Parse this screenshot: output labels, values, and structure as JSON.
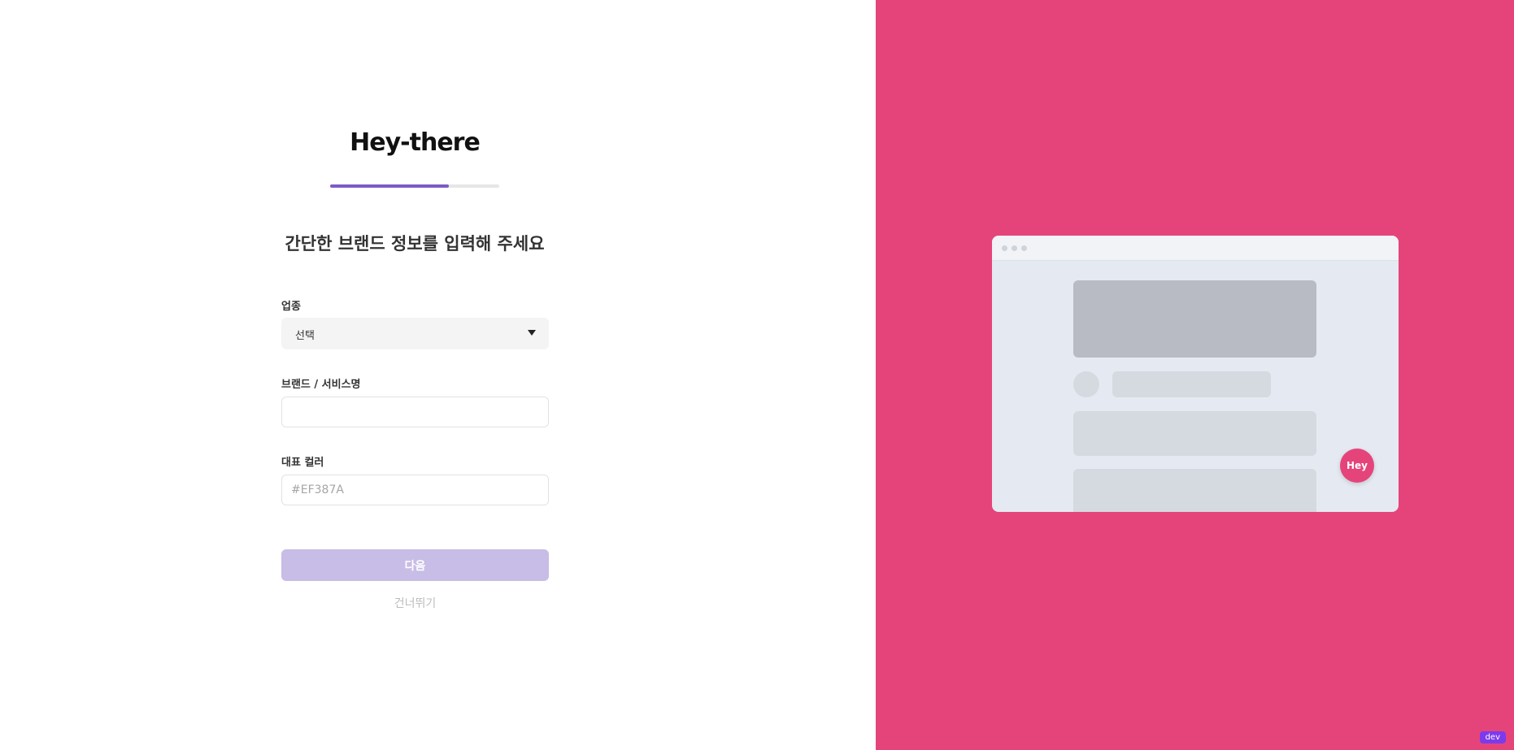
{
  "brand": {
    "logo_text": "Hey-there"
  },
  "onboarding": {
    "progress_fraction": 0.7,
    "progress_color": "#7b5bc4",
    "title": "간단한 브랜드 정보를 입력해 주세요",
    "industry": {
      "label": "업종",
      "selected_value": "선택"
    },
    "brand_name": {
      "label": "브랜드 / 서비스명",
      "value": "",
      "placeholder": ""
    },
    "color": {
      "label": "대표 컬러",
      "value": "",
      "placeholder": "#EF387A"
    },
    "next_label": "다음",
    "skip_label": "건너뛰기"
  },
  "preview": {
    "background_color": "#e5447b",
    "widget_label": "Hey"
  },
  "env_badge": "dev"
}
